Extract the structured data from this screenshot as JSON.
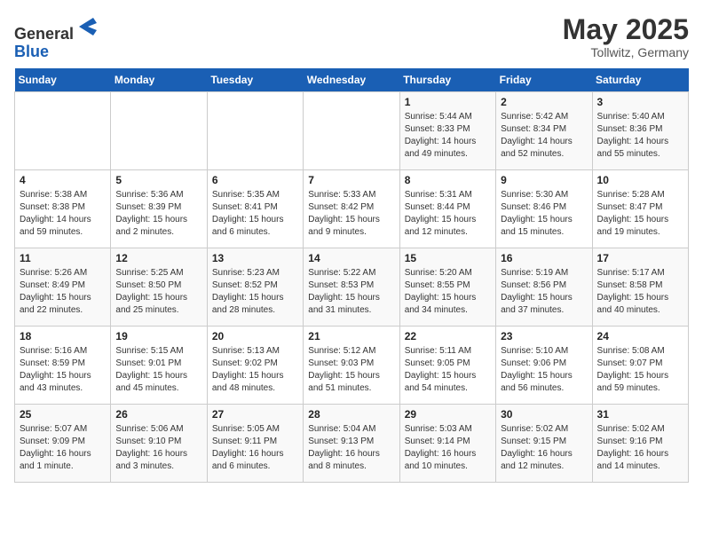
{
  "header": {
    "logo_line1": "General",
    "logo_line2": "Blue",
    "title": "May 2025",
    "subtitle": "Tollwitz, Germany"
  },
  "weekdays": [
    "Sunday",
    "Monday",
    "Tuesday",
    "Wednesday",
    "Thursday",
    "Friday",
    "Saturday"
  ],
  "weeks": [
    [
      {
        "day": "",
        "detail": ""
      },
      {
        "day": "",
        "detail": ""
      },
      {
        "day": "",
        "detail": ""
      },
      {
        "day": "",
        "detail": ""
      },
      {
        "day": "1",
        "detail": "Sunrise: 5:44 AM\nSunset: 8:33 PM\nDaylight: 14 hours\nand 49 minutes."
      },
      {
        "day": "2",
        "detail": "Sunrise: 5:42 AM\nSunset: 8:34 PM\nDaylight: 14 hours\nand 52 minutes."
      },
      {
        "day": "3",
        "detail": "Sunrise: 5:40 AM\nSunset: 8:36 PM\nDaylight: 14 hours\nand 55 minutes."
      }
    ],
    [
      {
        "day": "4",
        "detail": "Sunrise: 5:38 AM\nSunset: 8:38 PM\nDaylight: 14 hours\nand 59 minutes."
      },
      {
        "day": "5",
        "detail": "Sunrise: 5:36 AM\nSunset: 8:39 PM\nDaylight: 15 hours\nand 2 minutes."
      },
      {
        "day": "6",
        "detail": "Sunrise: 5:35 AM\nSunset: 8:41 PM\nDaylight: 15 hours\nand 6 minutes."
      },
      {
        "day": "7",
        "detail": "Sunrise: 5:33 AM\nSunset: 8:42 PM\nDaylight: 15 hours\nand 9 minutes."
      },
      {
        "day": "8",
        "detail": "Sunrise: 5:31 AM\nSunset: 8:44 PM\nDaylight: 15 hours\nand 12 minutes."
      },
      {
        "day": "9",
        "detail": "Sunrise: 5:30 AM\nSunset: 8:46 PM\nDaylight: 15 hours\nand 15 minutes."
      },
      {
        "day": "10",
        "detail": "Sunrise: 5:28 AM\nSunset: 8:47 PM\nDaylight: 15 hours\nand 19 minutes."
      }
    ],
    [
      {
        "day": "11",
        "detail": "Sunrise: 5:26 AM\nSunset: 8:49 PM\nDaylight: 15 hours\nand 22 minutes."
      },
      {
        "day": "12",
        "detail": "Sunrise: 5:25 AM\nSunset: 8:50 PM\nDaylight: 15 hours\nand 25 minutes."
      },
      {
        "day": "13",
        "detail": "Sunrise: 5:23 AM\nSunset: 8:52 PM\nDaylight: 15 hours\nand 28 minutes."
      },
      {
        "day": "14",
        "detail": "Sunrise: 5:22 AM\nSunset: 8:53 PM\nDaylight: 15 hours\nand 31 minutes."
      },
      {
        "day": "15",
        "detail": "Sunrise: 5:20 AM\nSunset: 8:55 PM\nDaylight: 15 hours\nand 34 minutes."
      },
      {
        "day": "16",
        "detail": "Sunrise: 5:19 AM\nSunset: 8:56 PM\nDaylight: 15 hours\nand 37 minutes."
      },
      {
        "day": "17",
        "detail": "Sunrise: 5:17 AM\nSunset: 8:58 PM\nDaylight: 15 hours\nand 40 minutes."
      }
    ],
    [
      {
        "day": "18",
        "detail": "Sunrise: 5:16 AM\nSunset: 8:59 PM\nDaylight: 15 hours\nand 43 minutes."
      },
      {
        "day": "19",
        "detail": "Sunrise: 5:15 AM\nSunset: 9:01 PM\nDaylight: 15 hours\nand 45 minutes."
      },
      {
        "day": "20",
        "detail": "Sunrise: 5:13 AM\nSunset: 9:02 PM\nDaylight: 15 hours\nand 48 minutes."
      },
      {
        "day": "21",
        "detail": "Sunrise: 5:12 AM\nSunset: 9:03 PM\nDaylight: 15 hours\nand 51 minutes."
      },
      {
        "day": "22",
        "detail": "Sunrise: 5:11 AM\nSunset: 9:05 PM\nDaylight: 15 hours\nand 54 minutes."
      },
      {
        "day": "23",
        "detail": "Sunrise: 5:10 AM\nSunset: 9:06 PM\nDaylight: 15 hours\nand 56 minutes."
      },
      {
        "day": "24",
        "detail": "Sunrise: 5:08 AM\nSunset: 9:07 PM\nDaylight: 15 hours\nand 59 minutes."
      }
    ],
    [
      {
        "day": "25",
        "detail": "Sunrise: 5:07 AM\nSunset: 9:09 PM\nDaylight: 16 hours\nand 1 minute."
      },
      {
        "day": "26",
        "detail": "Sunrise: 5:06 AM\nSunset: 9:10 PM\nDaylight: 16 hours\nand 3 minutes."
      },
      {
        "day": "27",
        "detail": "Sunrise: 5:05 AM\nSunset: 9:11 PM\nDaylight: 16 hours\nand 6 minutes."
      },
      {
        "day": "28",
        "detail": "Sunrise: 5:04 AM\nSunset: 9:13 PM\nDaylight: 16 hours\nand 8 minutes."
      },
      {
        "day": "29",
        "detail": "Sunrise: 5:03 AM\nSunset: 9:14 PM\nDaylight: 16 hours\nand 10 minutes."
      },
      {
        "day": "30",
        "detail": "Sunrise: 5:02 AM\nSunset: 9:15 PM\nDaylight: 16 hours\nand 12 minutes."
      },
      {
        "day": "31",
        "detail": "Sunrise: 5:02 AM\nSunset: 9:16 PM\nDaylight: 16 hours\nand 14 minutes."
      }
    ]
  ]
}
